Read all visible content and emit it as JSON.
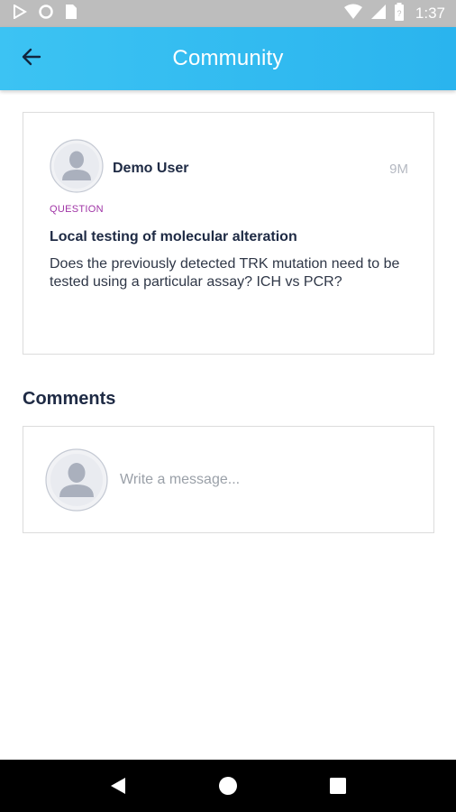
{
  "status_bar": {
    "time": "1:37",
    "icons": [
      "play-store-icon",
      "circle-notification-icon",
      "sim-card-icon",
      "wifi-icon",
      "signal-icon",
      "battery-icon"
    ]
  },
  "app_bar": {
    "title": "Community",
    "back_icon": "arrow-left-icon"
  },
  "post": {
    "author": "Demo User",
    "time_ago": "9M",
    "tag": "QUESTION",
    "title": "Local testing of molecular alteration",
    "body": "Does the previously detected TRK mutation need to be tested using a particular assay? ICH vs PCR?",
    "avatar_icon": "user-avatar-icon"
  },
  "comments": {
    "heading": "Comments",
    "input_placeholder": "Write a message...",
    "input_value": "",
    "avatar_icon": "user-avatar-icon"
  },
  "nav_bar": {
    "icons": [
      "back-triangle-icon",
      "home-circle-icon",
      "recents-square-icon"
    ]
  },
  "colors": {
    "app_bar": "#2ab4ee",
    "tag": "#a034a6",
    "text_dark": "#1e2a44",
    "status_bar": "#bdbdbd"
  }
}
